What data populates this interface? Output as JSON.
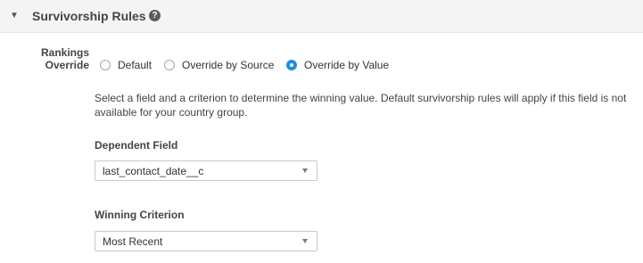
{
  "section": {
    "title": "Survivorship Rules",
    "help_icon": "question-circle-icon",
    "caret_icon": "caret-down-icon"
  },
  "rankings": {
    "label_line1": "Rankings",
    "label_line2": "Override",
    "options": [
      {
        "label": "Default",
        "checked": false
      },
      {
        "label": "Override by Source",
        "checked": false
      },
      {
        "label": "Override by Value",
        "checked": true
      }
    ]
  },
  "description": "Select a field and a criterion to determine the winning value. Default survivorship rules will apply if this field is not available for your country group.",
  "dependent_field": {
    "label": "Dependent Field",
    "value": "last_contact_date__c"
  },
  "winning_criterion": {
    "label": "Winning Criterion",
    "value": "Most Recent"
  },
  "colors": {
    "accent": "#1a8fe3",
    "header_bg": "#f4f4f4"
  }
}
